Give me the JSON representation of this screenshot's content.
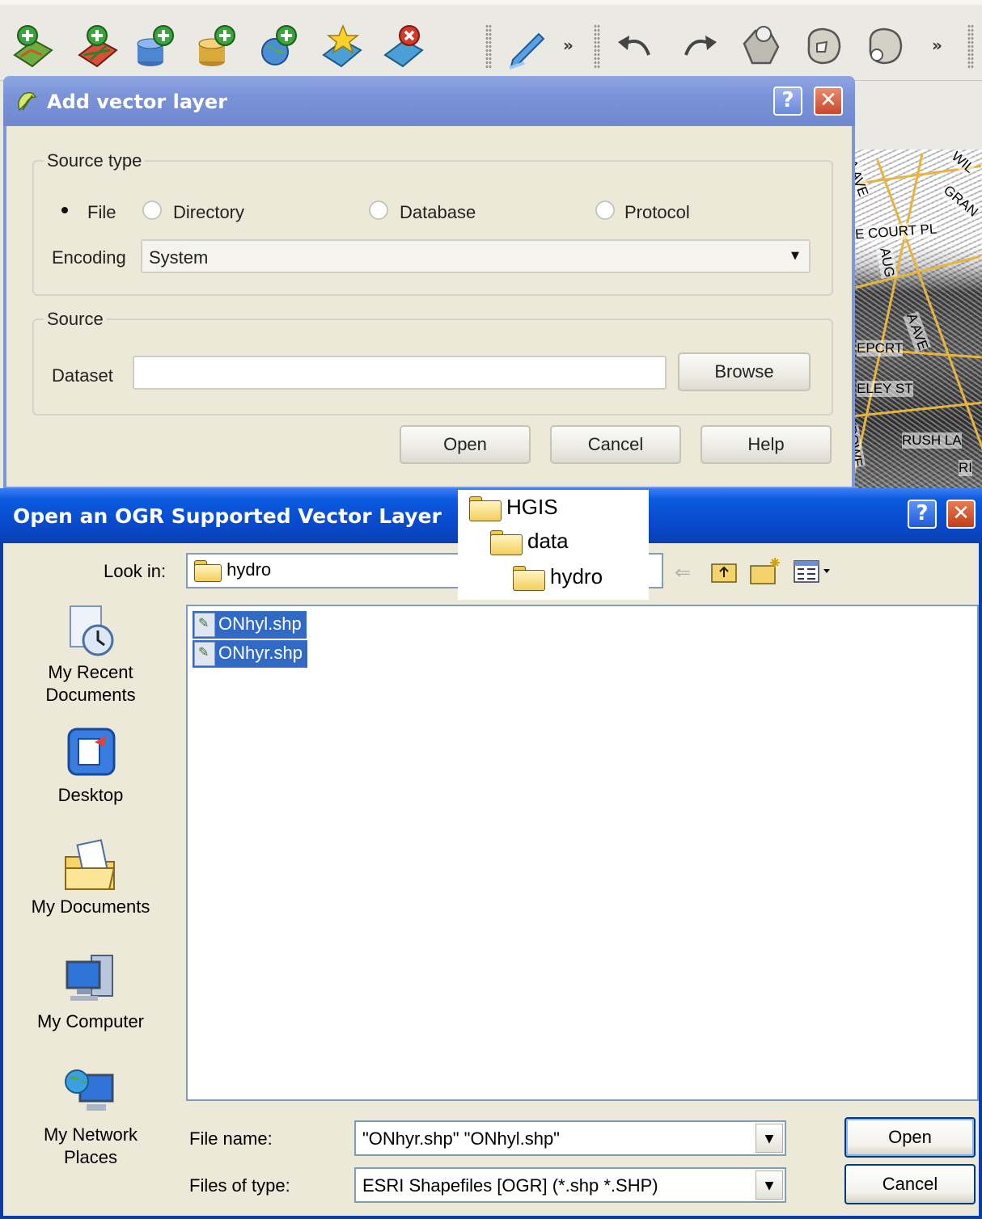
{
  "toolbar": {
    "icons": [
      "add-raster-layer-icon",
      "add-vector-layer-icon",
      "add-postgis-layer-icon",
      "add-spatialite-layer-icon",
      "add-wms-layer-icon",
      "new-shapefile-layer-icon",
      "remove-layer-icon",
      "toggle-editing-icon",
      "undo-icon",
      "redo-icon",
      "add-ring-icon",
      "add-part-icon",
      "fill-ring-icon"
    ],
    "more_label": "»"
  },
  "map": {
    "labels": [
      "A AVE",
      "WIL",
      "GRAN",
      "E COURT PL",
      "AUG",
      "A AVE",
      "EPCRT",
      "ELEY ST",
      "RUSH LA",
      "POWE",
      "RI"
    ]
  },
  "add_vector": {
    "title": "Add vector layer",
    "help_glyph": "?",
    "close_glyph": "✕",
    "source_type": {
      "label": "Source type",
      "options": [
        "File",
        "Directory",
        "Database",
        "Protocol"
      ],
      "selected": "File"
    },
    "encoding": {
      "label": "Encoding",
      "value": "System"
    },
    "source": {
      "label": "Source",
      "dataset_label": "Dataset",
      "dataset_value": "",
      "browse_label": "Browse"
    },
    "buttons": {
      "open": "Open",
      "cancel": "Cancel",
      "help": "Help"
    }
  },
  "open_ogr": {
    "title": "Open an OGR Supported Vector Layer",
    "help_glyph": "?",
    "close_glyph": "✕",
    "look_in_label": "Look in:",
    "look_in_value": "hydro",
    "places": [
      {
        "label_line1": "My Recent",
        "label_line2": "Documents"
      },
      {
        "label_line1": "Desktop",
        "label_line2": ""
      },
      {
        "label_line1": "My Documents",
        "label_line2": ""
      },
      {
        "label_line1": "My Computer",
        "label_line2": ""
      },
      {
        "label_line1": "My Network",
        "label_line2": "Places"
      }
    ],
    "files": [
      "ONhyl.shp",
      "ONhyr.shp"
    ],
    "file_name_label": "File name:",
    "file_name_value": "\"ONhyr.shp\" \"ONhyl.shp\"",
    "files_of_type_label": "Files of type:",
    "files_of_type_value": "ESRI Shapefiles [OGR] (*.shp *.SHP)",
    "open_label": "Open",
    "cancel_label": "Cancel"
  },
  "folder_tree": [
    "HGIS",
    "data",
    "hydro"
  ]
}
